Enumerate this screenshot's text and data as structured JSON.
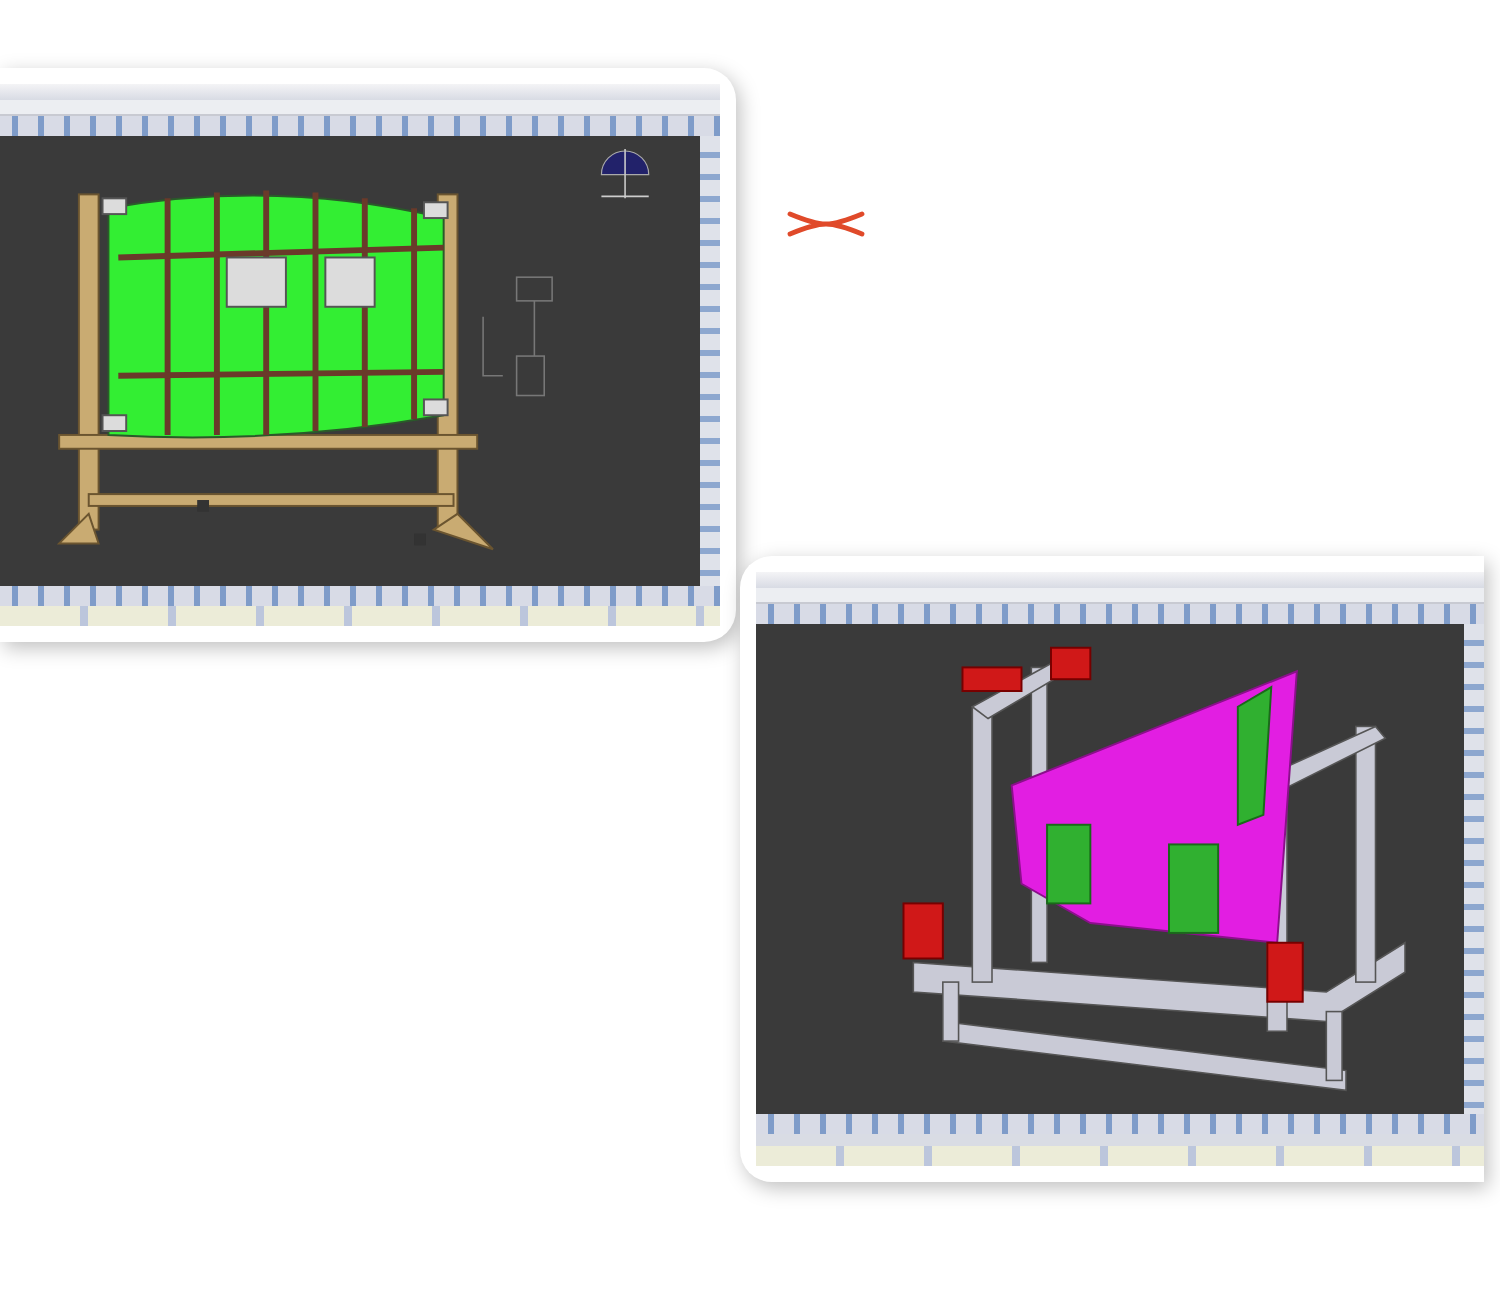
{
  "panels": [
    {
      "kind": "fixture-frame",
      "color": "#33ee33"
    },
    {
      "kind": "fixture-cube",
      "color": "#e21ee2"
    }
  ]
}
